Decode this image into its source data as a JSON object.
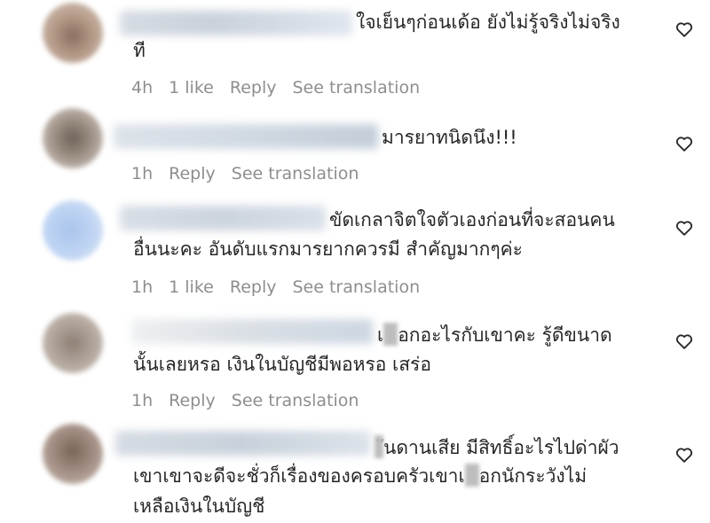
{
  "comments": [
    {
      "lines": [
        "ใจเย็นๆก่อนเด้อ ยังไม่รู้จริงไม่จริง",
        "ที"
      ],
      "time": "4h",
      "likes": "1 like",
      "reply": "Reply",
      "translate": "See translation"
    },
    {
      "lines": [
        "มารยาทนิดนึง!!!"
      ],
      "time": "1h",
      "likes": "",
      "reply": "Reply",
      "translate": "See translation"
    },
    {
      "lines": [
        "ขัดเกลาจิตใจตัวเองก่อนที่จะสอนคน",
        "อื่นนะคะ อันดับแรกมารยากควรมี สำคัญมากๆค่ะ"
      ],
      "time": "1h",
      "likes": "1 like",
      "reply": "Reply",
      "translate": "See translation"
    },
    {
      "lines": [
        "เ",
        "อกอะไรกับเขาคะ รู้ดีขนาด",
        "นั้นเลยหรอ เงินในบัญชีมีพอหรอ เสร่อ"
      ],
      "time": "1h",
      "likes": "",
      "reply": "Reply",
      "translate": "See translation"
    },
    {
      "lines": [
        "ันดานเสีย มีสิทธิ์อะไรไปด่าผัว",
        "เขาเขาจะดีจะชั่วก็เรื่องของครอบครัวเขาเ",
        "อกนักระวังไม่",
        "เหลือเงินในบัญชี"
      ]
    }
  ],
  "icons": {
    "like": "heart-outline-icon"
  },
  "colors": {
    "text": "#262626",
    "meta": "#8e8e8e"
  }
}
